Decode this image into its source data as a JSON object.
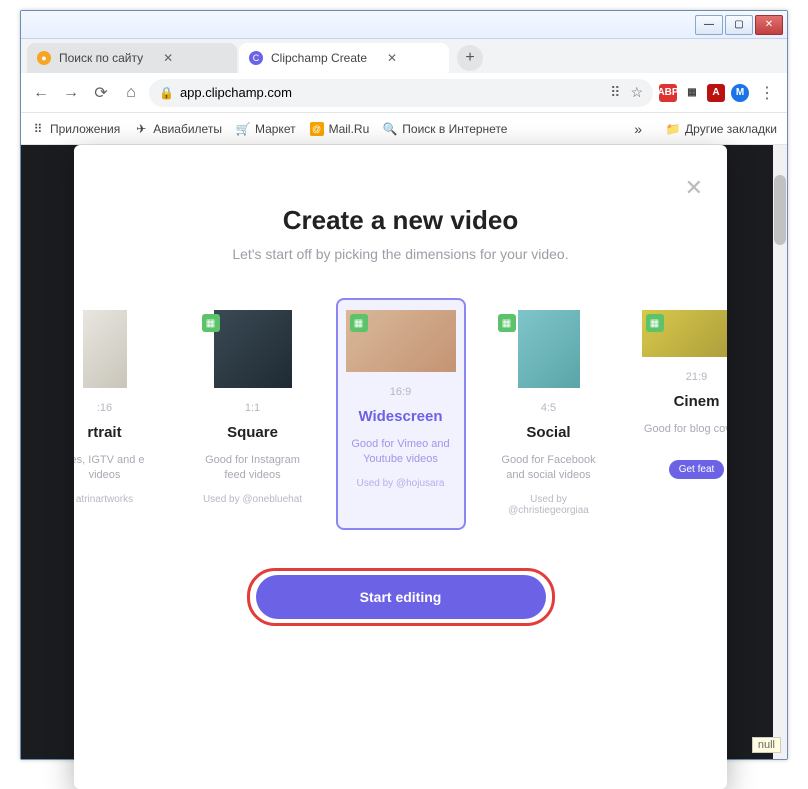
{
  "window": {
    "minimize": "—",
    "maximize": "▢",
    "close": "✕"
  },
  "tabs": {
    "tab0": {
      "label": "Поиск по сайту"
    },
    "tab1": {
      "label": "Clipchamp Create"
    }
  },
  "address": {
    "host": "app.clipchamp.com"
  },
  "bookmarks": {
    "apps": "Приложения",
    "avia": "Авиабилеты",
    "market": "Маркет",
    "mail": "Mail.Ru",
    "search": "Поиск в Интернете",
    "more": "»",
    "other": "Другие закладки"
  },
  "modal": {
    "title": "Create a new video",
    "subtitle": "Let's start off by picking the dimensions for your video.",
    "startLabel": "Start editing",
    "featuredLabel": "Get feat"
  },
  "options": {
    "portrait": {
      "ratio": ":16",
      "name": "rtrait",
      "desc": "ries, IGTV and e videos",
      "by": "atrinartworks"
    },
    "square": {
      "ratio": "1:1",
      "name": "Square",
      "desc": "Good for Instagram feed videos",
      "by": "Used by @onebluehat"
    },
    "widescreen": {
      "ratio": "16:9",
      "name": "Widescreen",
      "desc": "Good for Vimeo and Youtube videos",
      "by": "Used by @hojusara"
    },
    "social": {
      "ratio": "4:5",
      "name": "Social",
      "desc": "Good for Facebook and social videos",
      "by": "Used by @christiegeorgiaa"
    },
    "cinema": {
      "ratio": "21:9",
      "name": "Cinem",
      "desc": "Good for blog cover v",
      "by": ""
    }
  },
  "nullTag": "null"
}
